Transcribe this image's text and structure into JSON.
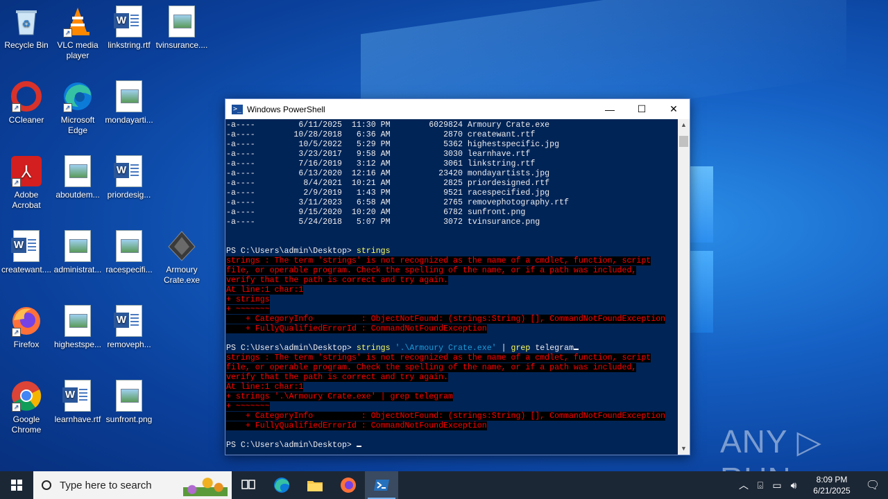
{
  "desktop": {
    "icons": [
      {
        "label": "Recycle Bin",
        "icon": "recycle-bin-icon"
      },
      {
        "label": "VLC media player",
        "icon": "vlc-icon"
      },
      {
        "label": "linkstring.rtf",
        "icon": "word-doc-icon"
      },
      {
        "label": "tvinsurance....",
        "icon": "image-file-icon"
      },
      {
        "label": "CCleaner",
        "icon": "ccleaner-icon"
      },
      {
        "label": "Microsoft Edge",
        "icon": "edge-icon"
      },
      {
        "label": "mondayarti...",
        "icon": "image-file-icon"
      },
      {
        "label": "Adobe Acrobat",
        "icon": "acrobat-icon"
      },
      {
        "label": "aboutdem...",
        "icon": "image-file-icon"
      },
      {
        "label": "priordesig...",
        "icon": "word-doc-icon"
      },
      {
        "label": "createwant....",
        "icon": "word-doc-icon"
      },
      {
        "label": "administrat...",
        "icon": "image-file-icon"
      },
      {
        "label": "racespecifi...",
        "icon": "image-file-icon"
      },
      {
        "label": "Armoury Crate.exe",
        "icon": "armoury-crate-icon"
      },
      {
        "label": "Firefox",
        "icon": "firefox-icon"
      },
      {
        "label": "highestspe...",
        "icon": "image-file-icon"
      },
      {
        "label": "removeph...",
        "icon": "word-doc-icon"
      },
      {
        "label": "Google Chrome",
        "icon": "chrome-icon"
      },
      {
        "label": "learnhave.rtf",
        "icon": "word-doc-icon"
      },
      {
        "label": "sunfront.png",
        "icon": "image-file-icon"
      }
    ]
  },
  "window": {
    "title": "Windows PowerShell",
    "minimize": "—",
    "maximize": "☐",
    "close": "✕"
  },
  "console": {
    "listing": [
      "-a----         6/11/2025  11:30 PM        6029824 Armoury Crate.exe",
      "-a----        10/28/2018   6:36 AM           2870 createwant.rtf",
      "-a----         10/5/2022   5:29 PM           5362 highestspecific.jpg",
      "-a----         3/23/2017   9:58 AM           3030 learnhave.rtf",
      "-a----         7/16/2019   3:12 AM           3061 linkstring.rtf",
      "-a----         6/13/2020  12:16 AM          23420 mondayartists.jpg",
      "-a----          8/4/2021  10:21 AM           2825 priordesigned.rtf",
      "-a----          2/9/2019   1:43 PM           9521 racespecified.jpg",
      "-a----         3/11/2023   6:58 AM           2765 removephotography.rtf",
      "-a----         9/15/2020  10:20 AM           6782 sunfront.png",
      "-a----         5/24/2018   5:07 PM           3072 tvinsurance.png"
    ],
    "prompt": "PS C:\\Users\\admin\\Desktop> ",
    "cmd1": "strings",
    "error1": [
      "strings : The term 'strings' is not recognized as the name of a cmdlet, function, script",
      "file, or operable program. Check the spelling of the name, or if a path was included,",
      "verify that the path is correct and try again.",
      "At line:1 char:1",
      "+ strings",
      "+ ~~~~~~~",
      "    + CategoryInfo          : ObjectNotFound: (strings:String) [], CommandNotFoundException",
      "    + FullyQualifiedErrorId : CommandNotFoundException"
    ],
    "cmd2_name": "strings",
    "cmd2_arg": "'.\\Armoury Crate.exe'",
    "cmd2_pipe": " | ",
    "cmd2_grep": "grep",
    "cmd2_rest": " telegram",
    "error2": [
      "strings : The term 'strings' is not recognized as the name of a cmdlet, function, script",
      "file, or operable program. Check the spelling of the name, or if a path was included,",
      "verify that the path is correct and try again.",
      "At line:1 char:1",
      "+ strings '.\\Armoury Crate.exe' | grep telegram",
      "+ ~~~~~~~",
      "    + CategoryInfo          : ObjectNotFound: (strings:String) [], CommandNotFoundException",
      "    + FullyQualifiedErrorId : CommandNotFoundException"
    ]
  },
  "watermark": "ANY ▷ RUN",
  "taskbar": {
    "search_placeholder": "Type here to search",
    "time": "8:09 PM",
    "date": "6/21/2025"
  }
}
